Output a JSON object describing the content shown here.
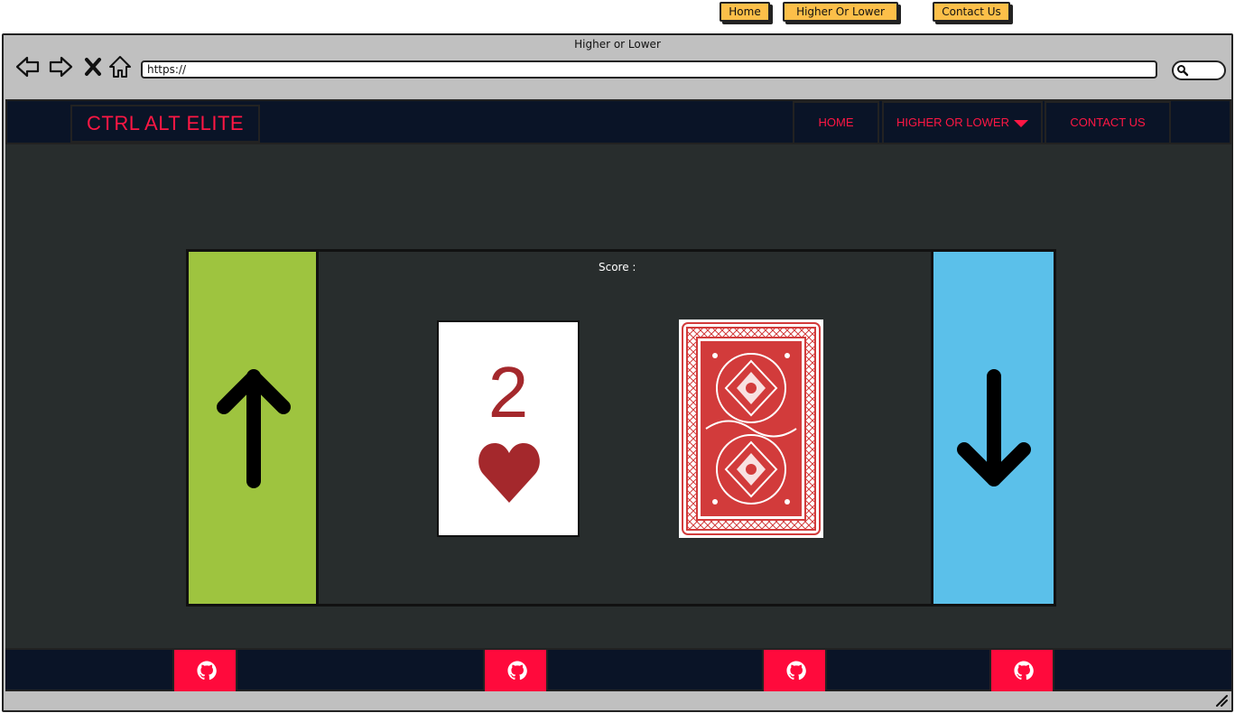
{
  "wireframe_nav": {
    "home": "Home",
    "higher_or_lower": "Higher Or Lower",
    "contact_us": "Contact Us"
  },
  "browser": {
    "title": "Higher or Lower",
    "url": "https://"
  },
  "site": {
    "logo": "CTRL ALT ELITE",
    "menu": {
      "home": "HOME",
      "higher_or_lower": "HIGHER OR LOWER",
      "contact_us": "CONTACT US"
    }
  },
  "game": {
    "score_label": "Score :",
    "current_card": {
      "rank": "2",
      "suit": "hearts"
    }
  },
  "footer": {
    "github_links": [
      "github-icon",
      "github-icon",
      "github-icon",
      "github-icon"
    ]
  },
  "colors": {
    "brand_red": "#ff1744",
    "navy": "#0a1427",
    "higher_green": "#9ec43f",
    "lower_blue": "#5bc0ea",
    "card_red": "#a4282c",
    "wireframe_button": "#fcbf49"
  }
}
